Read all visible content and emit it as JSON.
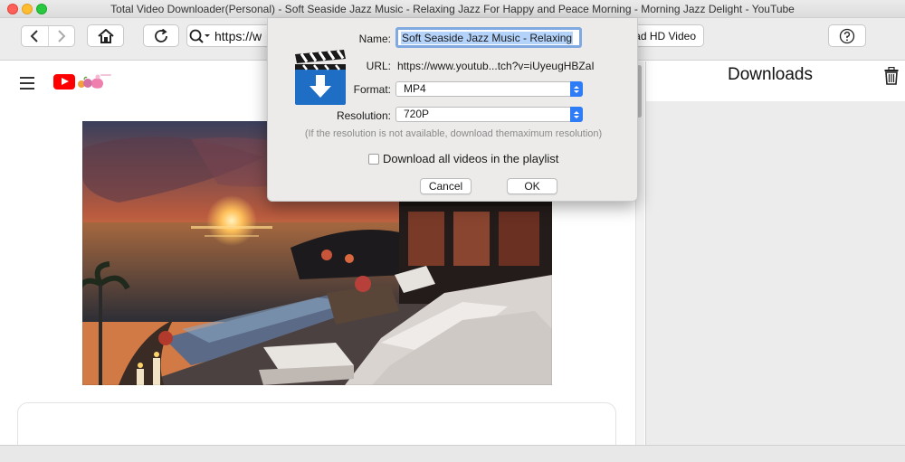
{
  "window": {
    "title": "Total Video Downloader(Personal) - Soft Seaside Jazz Music - Relaxing Jazz For Happy and Peace Morning - Morning Jazz Delight - YouTube"
  },
  "toolbar": {
    "url_text": "https://w",
    "download_hd_label": "oad HD Video"
  },
  "downloads_panel": {
    "title": "Downloads"
  },
  "dialog": {
    "name_label": "Name:",
    "name_value": "Soft Seaside Jazz Music - Relaxing",
    "url_label": "URL:",
    "url_value": "https://www.youtub...tch?v=iUyeugHBZaI",
    "format_label": "Format:",
    "format_value": "MP4",
    "resolution_label": "Resolution:",
    "resolution_value": "720P",
    "note": "(If the resolution is not available, download themaximum resolution)",
    "playlist_checkbox_label": "Download all videos in the playlist",
    "playlist_checked": false,
    "cancel_label": "Cancel",
    "ok_label": "OK"
  },
  "colors": {
    "accent_blue": "#2e7cf6",
    "youtube_red": "#ff0000",
    "selection": "#b4d3fb"
  },
  "icons": [
    "back-icon",
    "forward-icon",
    "home-icon",
    "reload-icon",
    "search-icon",
    "help-icon",
    "trash-icon",
    "menu-icon",
    "clapperboard-download-icon"
  ]
}
